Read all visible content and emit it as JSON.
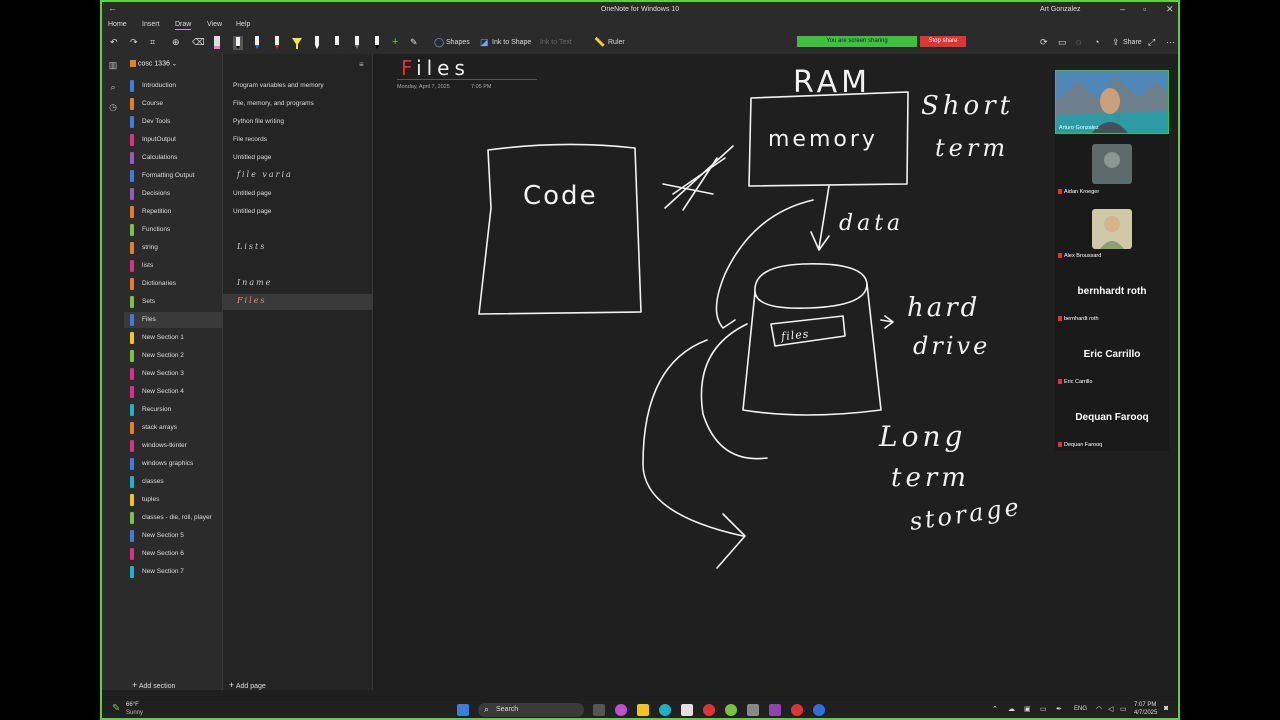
{
  "window": {
    "title": "OneNote for Windows 10",
    "user": "Art Gonzalez"
  },
  "menu": {
    "home": "Home",
    "insert": "Insert",
    "draw": "Draw",
    "view": "View",
    "help": "Help"
  },
  "toolbar": {
    "shapes": "Shapes",
    "ink_to_shape": "Ink to Shape",
    "ink_to_text": "Ink to Text",
    "ruler": "Ruler",
    "screen_sharing": "You are screen sharing",
    "stop_share": "Stop share",
    "share": "Share",
    "accent_color": "#c98ee8"
  },
  "notebook": {
    "name": "cosc 1336"
  },
  "sections": [
    {
      "label": "Introduction",
      "color": "#3c7dd9"
    },
    {
      "label": "Course",
      "color": "#e67e22"
    },
    {
      "label": "Dev Tools",
      "color": "#3c7dd9"
    },
    {
      "label": "InputOutput",
      "color": "#d63384"
    },
    {
      "label": "Calculations",
      "color": "#9b59b6"
    },
    {
      "label": "Formatting Output",
      "color": "#3c7dd9"
    },
    {
      "label": "Decisions",
      "color": "#9b59b6"
    },
    {
      "label": "Repetition",
      "color": "#e67e22"
    },
    {
      "label": "Functions",
      "color": "#7cc242"
    },
    {
      "label": "string",
      "color": "#e67e22"
    },
    {
      "label": "lists",
      "color": "#d63384"
    },
    {
      "label": "Dictionaries",
      "color": "#e67e22"
    },
    {
      "label": "Sets",
      "color": "#7cc242"
    },
    {
      "label": "Files",
      "color": "#3c7dd9",
      "selected": true
    },
    {
      "label": "New Section 1",
      "color": "#f0c419"
    },
    {
      "label": "New Section 2",
      "color": "#7cc242"
    },
    {
      "label": "New Section 3",
      "color": "#d63384"
    },
    {
      "label": "New Section 4",
      "color": "#d63384"
    },
    {
      "label": "Recursion",
      "color": "#1ab3c9"
    },
    {
      "label": "stack arrays",
      "color": "#e67e22"
    },
    {
      "label": "windows-tkinter",
      "color": "#d63384"
    },
    {
      "label": "windows graphics",
      "color": "#3c7dd9"
    },
    {
      "label": "classes",
      "color": "#1ab3c9"
    },
    {
      "label": "tuples",
      "color": "#f0c419"
    },
    {
      "label": "classes - die, roll, player",
      "color": "#7cc242"
    },
    {
      "label": "New Section 5",
      "color": "#3c7dd9"
    },
    {
      "label": "New Section 6",
      "color": "#d63384"
    },
    {
      "label": "New Section 7",
      "color": "#1ab3c9"
    }
  ],
  "pages": [
    {
      "label": "Program variables and memory",
      "ink": false
    },
    {
      "label": "File, memory, and programs",
      "ink": false
    },
    {
      "label": "Python file writing",
      "ink": false
    },
    {
      "label": "File records",
      "ink": false
    },
    {
      "label": "Untitled page",
      "ink": false
    },
    {
      "label": "file varia",
      "ink": true
    },
    {
      "label": "Untitled page",
      "ink": false
    },
    {
      "label": "Untitled page",
      "ink": false
    },
    {
      "label": "",
      "ink": false
    },
    {
      "label": "Lists",
      "ink": true
    },
    {
      "label": "",
      "ink": false
    },
    {
      "label": "Iname",
      "ink": true
    },
    {
      "label": "Files",
      "ink": true,
      "selected": true
    }
  ],
  "add_section": "Add section",
  "add_page": "Add page",
  "page": {
    "title_first": "F",
    "title_rest": "iles",
    "date": "Monday, April 7, 2025",
    "time": "7:05 PM"
  },
  "ink": {
    "ram": "RAM",
    "memory": "memory",
    "short": "Short",
    "term_1": "term",
    "code": "Code",
    "data": "data",
    "files": "files",
    "hard": "hard",
    "drive": "drive",
    "long": "Long",
    "term_2": "term",
    "storage": "storage"
  },
  "participants": [
    {
      "name": "Arturo Gonzalez",
      "video": true
    },
    {
      "name": "Aidan Kroeger",
      "video": true
    },
    {
      "name": "Alex Broussard",
      "video": true
    },
    {
      "name": "bernhardt roth",
      "big": "bernhardt roth"
    },
    {
      "name": "Eric Carrillo",
      "big": "Eric Carrillo"
    },
    {
      "name": "Dequan Farooq",
      "big": "Dequan Farooq"
    }
  ],
  "taskbar": {
    "temp": "66°F",
    "weather": "Sunny",
    "search": "Search",
    "lang": "ENG",
    "time": "7:07 PM",
    "date": "4/7/2025"
  }
}
